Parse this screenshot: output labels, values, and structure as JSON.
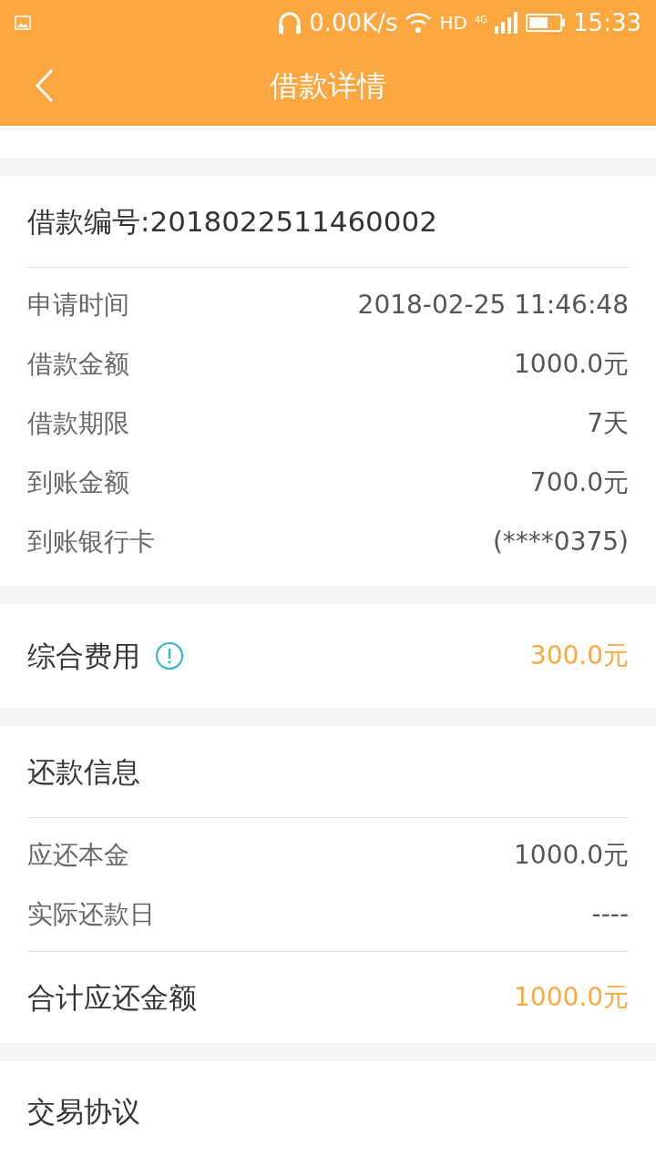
{
  "status_bar": {
    "network_speed": "0.00K/s",
    "hd": "HD",
    "network": "4G",
    "time": "15:33"
  },
  "header": {
    "title": "借款详情"
  },
  "loan": {
    "title": "借款编号:2018022511460002",
    "rows": [
      {
        "label": "申请时间",
        "value": "2018-02-25 11:46:48"
      },
      {
        "label": "借款金额",
        "value": "1000.0元"
      },
      {
        "label": "借款期限",
        "value": "7天"
      },
      {
        "label": "到账金额",
        "value": "700.0元"
      },
      {
        "label": "到账银行卡",
        "value": "(****0375)"
      }
    ]
  },
  "fee": {
    "label": "综合费用",
    "value": "300.0元"
  },
  "repayment": {
    "title": "还款信息",
    "rows": [
      {
        "label": "应还本金",
        "value": "1000.0元"
      },
      {
        "label": "实际还款日",
        "value": "----"
      }
    ],
    "total": {
      "label": "合计应还金额",
      "value": "1000.0元"
    }
  },
  "agreement": {
    "title": "交易协议"
  }
}
